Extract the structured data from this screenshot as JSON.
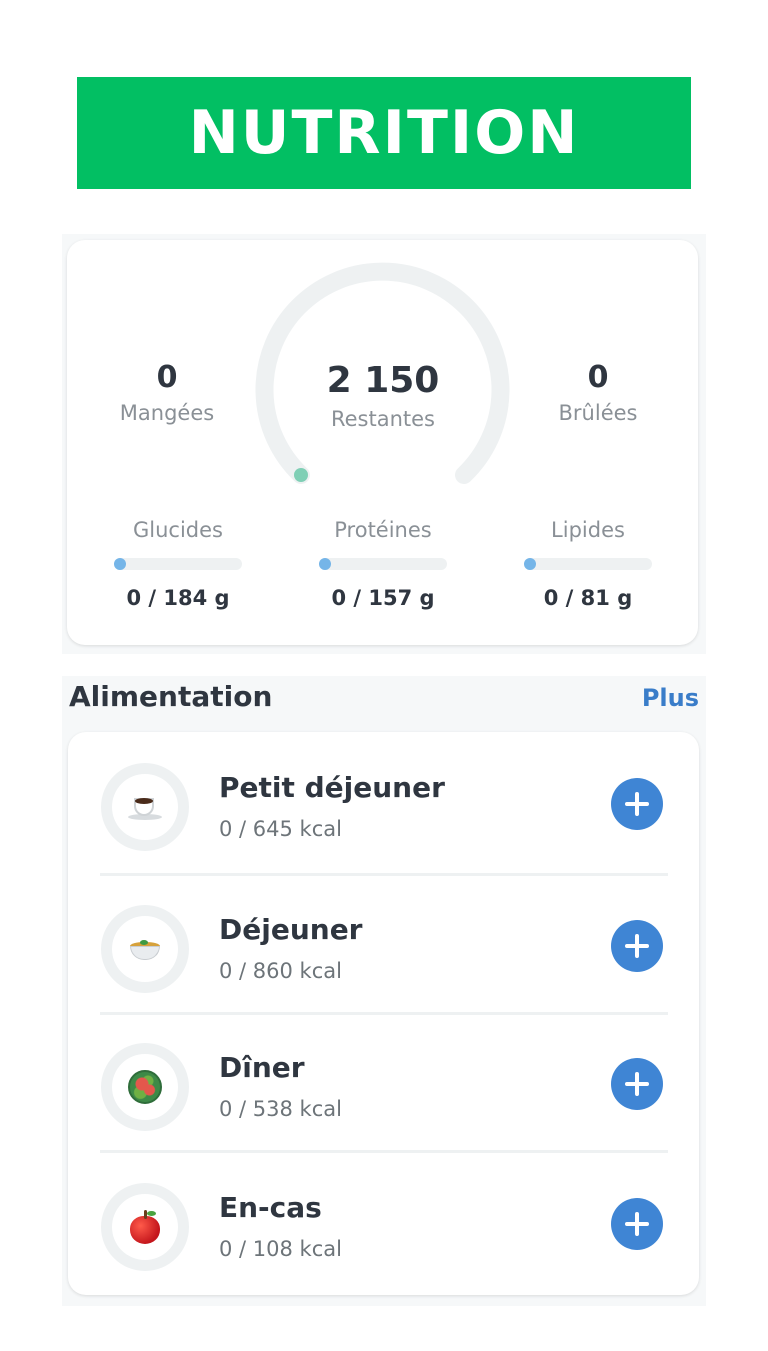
{
  "header": {
    "title": "NUTRITION"
  },
  "summary": {
    "eaten": {
      "value": "0",
      "label": "Mangées"
    },
    "remaining": {
      "value": "2 150",
      "label": "Restantes"
    },
    "burned": {
      "value": "0",
      "label": "Brûlées"
    },
    "macros": [
      {
        "label": "Glucides",
        "value": "0 / 184 g",
        "progress": 0
      },
      {
        "label": "Protéines",
        "value": "0 / 157 g",
        "progress": 0
      },
      {
        "label": "Lipides",
        "value": "0 / 81 g",
        "progress": 0
      }
    ],
    "gauge_progress": 0
  },
  "section": {
    "title": "Alimentation",
    "more_label": "Plus"
  },
  "meals": [
    {
      "name": "Petit déjeuner",
      "kcal": "0 / 645 kcal",
      "icon": "coffee-icon"
    },
    {
      "name": "Déjeuner",
      "kcal": "0 / 860 kcal",
      "icon": "soup-bowl-icon"
    },
    {
      "name": "Dîner",
      "kcal": "0 / 538 kcal",
      "icon": "salad-icon"
    },
    {
      "name": "En-cas",
      "kcal": "0 / 108 kcal",
      "icon": "apple-icon"
    }
  ],
  "colors": {
    "banner": "#02bf63",
    "accent_blue": "#3f85d4",
    "link_blue": "#3a7dc9",
    "gauge_dot": "#7fcfb5",
    "macro_dot": "#75b5e8"
  }
}
